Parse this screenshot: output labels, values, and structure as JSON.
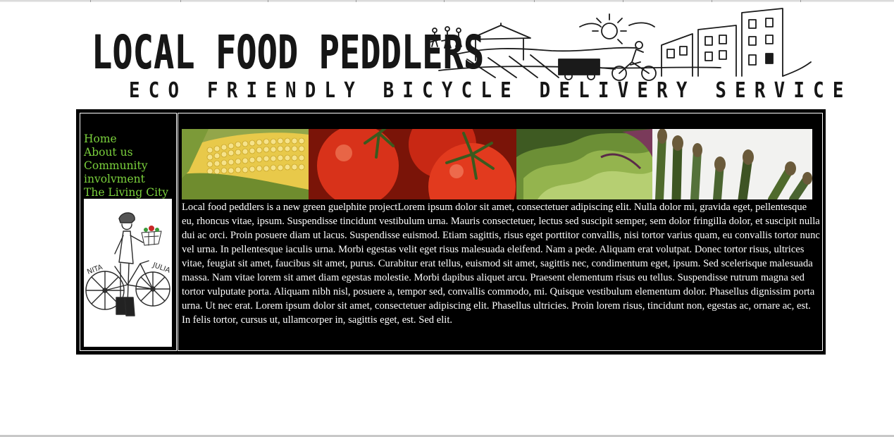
{
  "header": {
    "logo_text": "LOCAL FOOD PEDDLERS",
    "tagline": "ECO FRIENDLY BICYCLE DELIVERY SERVICE"
  },
  "nav": {
    "items": [
      {
        "label": "Home"
      },
      {
        "label": "About us"
      },
      {
        "label": "Community"
      },
      {
        "label": "involvment"
      },
      {
        "label": "The Living City"
      }
    ]
  },
  "bike_card": {
    "left_label": "NITA",
    "right_label": "JULIA"
  },
  "photos": [
    {
      "icon": "corn-photo"
    },
    {
      "icon": "tomatoes-photo"
    },
    {
      "icon": "lettuce-photo"
    },
    {
      "icon": "asparagus-photo"
    }
  ],
  "content": {
    "paragraph": "Local food peddlers is a new green guelphite projectLorem ipsum dolor sit amet, consectetuer adipiscing elit. Nulla dolor mi, gravida eget, pellentesque eu, rhoncus vitae, ipsum. Suspendisse tincidunt vestibulum urna. Mauris consectetuer, lectus sed suscipit semper, sem dolor fringilla dolor, et suscipit nulla dui ac orci. Proin posuere diam ut lacus. Suspendisse euismod. Etiam sagittis, risus eget porttitor convallis, nisi tortor varius quam, eu convallis tortor nunc vel urna. In pellentesque iaculis urna. Morbi egestas velit eget risus malesuada eleifend. Nam a pede. Aliquam erat volutpat. Donec tortor risus, ultrices vitae, feugiat sit amet, faucibus sit amet, purus. Curabitur erat tellus, euismod sit amet, sagittis nec, condimentum eget, ipsum. Sed scelerisque malesuada massa. Nam vitae lorem sit amet diam egestas molestie. Morbi dapibus aliquet arcu. Praesent elementum risus eu tellus. Suspendisse rutrum magna sed tortor vulputate porta. Aliquam nibh nisl, posuere a, tempor sed, convallis commodo, mi. Quisque vestibulum elementum dolor. Phasellus dignissim porta urna. Ut nec erat. Lorem ipsum dolor sit amet, consectetuer adipiscing elit. Phasellus ultricies. Proin lorem risus, tincidunt non, egestas ac, ornare ac, est. In felis tortor, cursus ut, ullamcorper in, sagittis eget, est. Sed elit."
  },
  "colors": {
    "page_background": "#ffffff",
    "main_background": "#000000",
    "nav_link": "#7ad03c",
    "body_text": "#ffffff"
  }
}
